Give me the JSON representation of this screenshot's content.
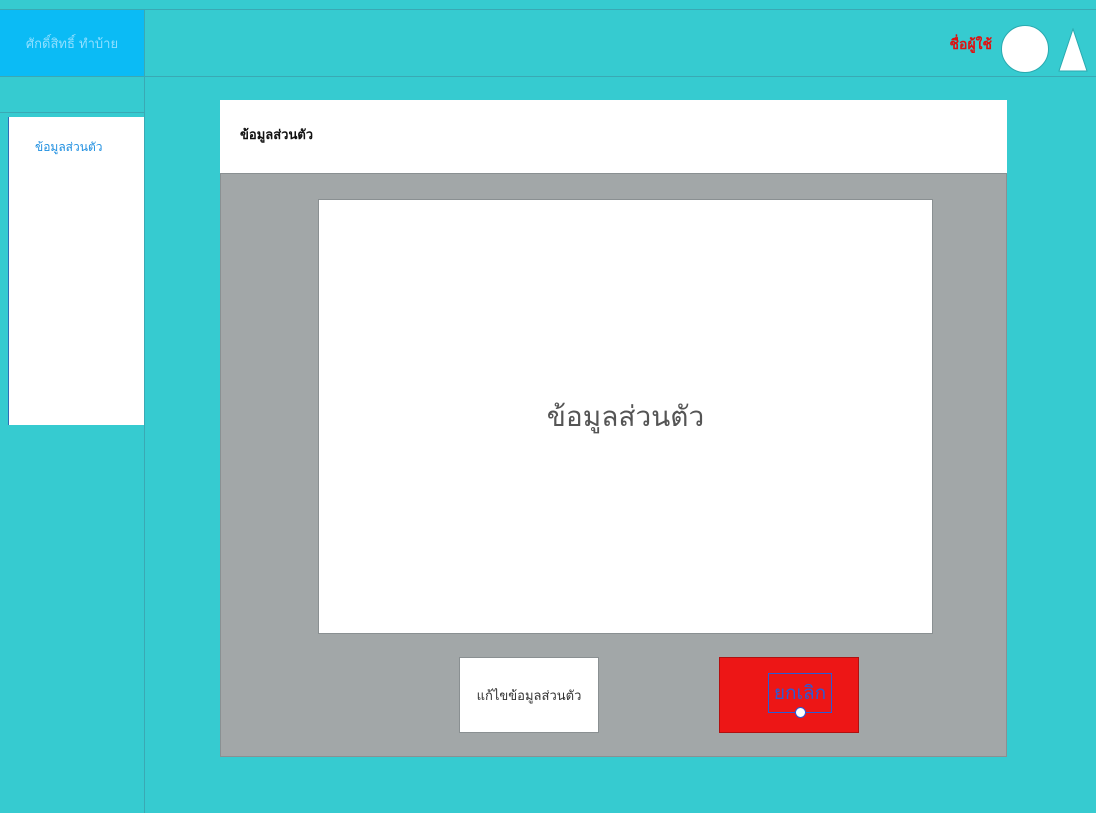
{
  "brand": {
    "label": "ศักดิ์สิทธิ์ ทำบ้าย"
  },
  "header": {
    "username": "ชื่อผู้ใช้"
  },
  "sidebar": {
    "items": [
      {
        "label": "ข้อมูลส่วนตัว"
      }
    ]
  },
  "card": {
    "title": "ข้อมูลส่วนตัว",
    "content_label": "ข้อมูลส่วนตัว",
    "edit_label": "แก้ไขข้อมูลส่วนตัว",
    "cancel_label": "ยกเลิก"
  },
  "icons": {
    "avatar": "avatar-circle-icon",
    "menu": "triangle-menu-icon"
  },
  "colors": {
    "background": "#36cbd0",
    "brand_block": "#0bbbf5",
    "username": "#e01010",
    "card_body": "#a2a7a8",
    "cancel_button": "#ed1616"
  }
}
